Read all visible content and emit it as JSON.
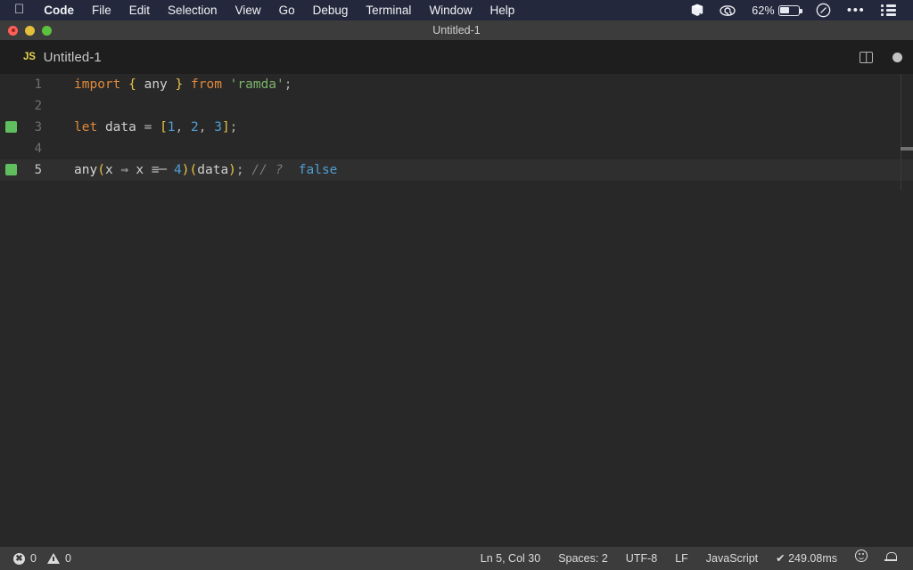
{
  "menubar": {
    "apple_icon": "apple-logo-icon",
    "items": [
      {
        "label": "Code",
        "bold": true
      },
      {
        "label": "File",
        "bold": false
      },
      {
        "label": "Edit",
        "bold": false
      },
      {
        "label": "Selection",
        "bold": false
      },
      {
        "label": "View",
        "bold": false
      },
      {
        "label": "Go",
        "bold": false
      },
      {
        "label": "Debug",
        "bold": false
      },
      {
        "label": "Terminal",
        "bold": false
      },
      {
        "label": "Window",
        "bold": false
      },
      {
        "label": "Help",
        "bold": false
      }
    ],
    "status_icons": [
      {
        "name": "dropbox-cube-icon",
        "glyph": "⬟"
      },
      {
        "name": "spiral-eye-icon",
        "glyph": "◎"
      }
    ],
    "battery": {
      "percent": "62%",
      "fill_ratio": 0.5
    },
    "siri_icon": "siri-circle-icon",
    "overflow_icon": "three-dots-icon",
    "control_center_icon": "control-center-list-icon",
    "bg_color": "#23283c"
  },
  "titlebar": {
    "title": "Untitled-1",
    "traffic_lights": [
      "close-red",
      "minimize-yellow",
      "zoom-green"
    ],
    "bg_color": "#3c3c3c"
  },
  "tabbar": {
    "tab": {
      "badge": "JS",
      "label": "Untitled-1",
      "badge_color": "#e8d44d"
    },
    "split_editor_icon": "split-editor-icon",
    "unsaved_dot_icon": "unsaved-dot-icon"
  },
  "editor": {
    "bg_color": "#282828",
    "active_line": 5,
    "lines": [
      {
        "number": "1",
        "gutter_change": false,
        "tokens": [
          {
            "text": "import",
            "cls": "t-kw"
          },
          {
            "text": " ",
            "cls": "t-plain"
          },
          {
            "text": "{",
            "cls": "t-brace"
          },
          {
            "text": " ",
            "cls": "t-plain"
          },
          {
            "text": "any",
            "cls": "t-plain"
          },
          {
            "text": " ",
            "cls": "t-plain"
          },
          {
            "text": "}",
            "cls": "t-brace"
          },
          {
            "text": " ",
            "cls": "t-plain"
          },
          {
            "text": "from",
            "cls": "t-kw"
          },
          {
            "text": " ",
            "cls": "t-plain"
          },
          {
            "text": "'ramda'",
            "cls": "t-str"
          },
          {
            "text": ";",
            "cls": "t-punc"
          }
        ]
      },
      {
        "number": "2",
        "gutter_change": false,
        "tokens": []
      },
      {
        "number": "3",
        "gutter_change": true,
        "tokens": [
          {
            "text": "let",
            "cls": "t-kw"
          },
          {
            "text": " ",
            "cls": "t-plain"
          },
          {
            "text": "data",
            "cls": "t-plain"
          },
          {
            "text": " ",
            "cls": "t-plain"
          },
          {
            "text": "=",
            "cls": "t-op"
          },
          {
            "text": " ",
            "cls": "t-plain"
          },
          {
            "text": "[",
            "cls": "t-bracket"
          },
          {
            "text": "1",
            "cls": "t-num"
          },
          {
            "text": ", ",
            "cls": "t-punc"
          },
          {
            "text": "2",
            "cls": "t-num"
          },
          {
            "text": ", ",
            "cls": "t-punc"
          },
          {
            "text": "3",
            "cls": "t-num"
          },
          {
            "text": "]",
            "cls": "t-bracket"
          },
          {
            "text": ";",
            "cls": "t-punc"
          }
        ]
      },
      {
        "number": "4",
        "gutter_change": false,
        "tokens": []
      },
      {
        "number": "5",
        "gutter_change": true,
        "tokens": [
          {
            "text": "any",
            "cls": "t-fn"
          },
          {
            "text": "(",
            "cls": "t-paren"
          },
          {
            "text": "x",
            "cls": "t-plain"
          },
          {
            "text": " ",
            "cls": "t-plain"
          },
          {
            "text": "⇒",
            "cls": "t-op lig"
          },
          {
            "text": " ",
            "cls": "t-plain"
          },
          {
            "text": "x",
            "cls": "t-plain"
          },
          {
            "text": " ",
            "cls": "t-plain"
          },
          {
            "text": "≡─",
            "cls": "t-op lig"
          },
          {
            "text": " ",
            "cls": "t-plain"
          },
          {
            "text": "4",
            "cls": "t-num"
          },
          {
            "text": ")",
            "cls": "t-paren"
          },
          {
            "text": "(",
            "cls": "t-paren"
          },
          {
            "text": "data",
            "cls": "t-plain"
          },
          {
            "text": ")",
            "cls": "t-paren"
          },
          {
            "text": ";",
            "cls": "t-punc"
          },
          {
            "text": " ",
            "cls": "t-plain"
          },
          {
            "text": "// ?",
            "cls": "t-comment"
          },
          {
            "text": "  ",
            "cls": "t-plain"
          },
          {
            "text": "false",
            "cls": "t-out"
          }
        ]
      }
    ],
    "source_text": "import { any } from 'ramda';\n\nlet data = [1, 2, 3];\n\nany(x => x === 4)(data); // ?  false"
  },
  "statusbar": {
    "errors": "0",
    "warnings": "0",
    "cursor": "Ln 5, Col 30",
    "indent": "Spaces: 2",
    "encoding": "UTF-8",
    "eol": "LF",
    "language": "JavaScript",
    "runtime": "✔ 249.08ms",
    "feedback_icon": "smiley-face-icon",
    "notifications_icon": "bell-icon",
    "bg_color": "#3c3c3c"
  }
}
